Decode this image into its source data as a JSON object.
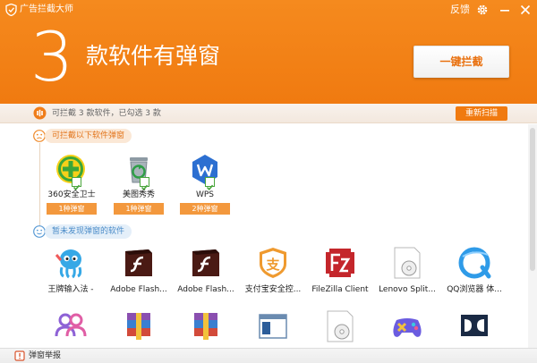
{
  "window": {
    "title": "广告拦截大师",
    "feedback_label": "反馈",
    "icons": [
      "shield-logo-icon",
      "gear-icon",
      "minimize-icon",
      "close-icon"
    ]
  },
  "hero": {
    "count": "3",
    "headline": "款软件有弹窗",
    "block_all_label": "一键拦截"
  },
  "summary": {
    "text": "可拦截 3 款软件，已勾选 3 款",
    "rescan_label": "重新扫描"
  },
  "blockable": {
    "label": "可拦截以下软件弹窗",
    "apps": [
      {
        "name": "360安全卫士",
        "count": "1种弹窗",
        "icon": "360-security-icon"
      },
      {
        "name": "美图秀秀",
        "count": "1种弹窗",
        "icon": "meitu-recycle-icon"
      },
      {
        "name": "WPS",
        "count": "2种弹窗",
        "icon": "wps-icon"
      }
    ]
  },
  "no_popup": {
    "label": "暂未发现弹窗的软件",
    "apps": [
      {
        "name": "王牌输入法 -",
        "icon": "octopus-ime-icon"
      },
      {
        "name": "Adobe Flash...",
        "icon": "adobe-flash-icon"
      },
      {
        "name": "Adobe Flash...",
        "icon": "adobe-flash-icon"
      },
      {
        "name": "支付宝安全控...",
        "icon": "alipay-icon"
      },
      {
        "name": "FileZilla Client",
        "icon": "filezilla-icon"
      },
      {
        "name": "Lenovo Split...",
        "icon": "disc-icon"
      },
      {
        "name": "QQ浏览器 体...",
        "icon": "qq-browser-icon"
      }
    ],
    "row2_icons": [
      "users-icon",
      "winrar-icon",
      "winrar-icon",
      "window-app-icon",
      "disc-icon",
      "gamepad-icon",
      "dolby-icon"
    ]
  },
  "footer": {
    "report_label": "弹窗举报"
  },
  "colors": {
    "accent": "#f07a10",
    "blue_label": "#4a8bc8",
    "check_green": "#4aa63c"
  }
}
